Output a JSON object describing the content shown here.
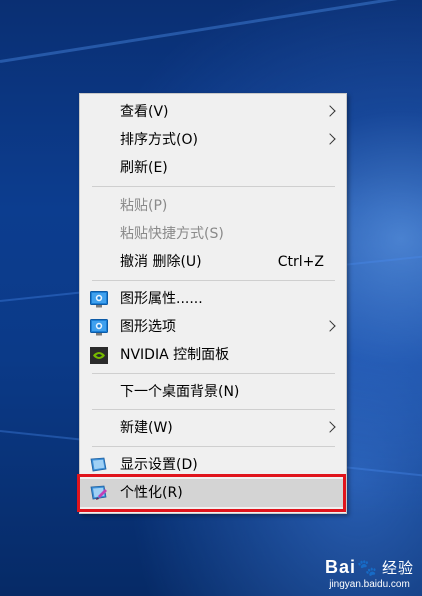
{
  "menu": {
    "items": [
      {
        "label": "查看(V)",
        "submenu": true
      },
      {
        "label": "排序方式(O)",
        "submenu": true
      },
      {
        "label": "刷新(E)"
      },
      {
        "label": "粘贴(P)",
        "disabled": true
      },
      {
        "label": "粘贴快捷方式(S)",
        "disabled": true
      },
      {
        "label": "撤消 删除(U)",
        "shortcut": "Ctrl+Z"
      },
      {
        "label": "图形属性......",
        "icon": "intel-graphics-icon"
      },
      {
        "label": "图形选项",
        "icon": "intel-graphics-icon",
        "submenu": true
      },
      {
        "label": "NVIDIA 控制面板",
        "icon": "nvidia-icon"
      },
      {
        "label": "下一个桌面背景(N)"
      },
      {
        "label": "新建(W)",
        "submenu": true
      },
      {
        "label": "显示设置(D)",
        "icon": "display-settings-icon"
      },
      {
        "label": "个性化(R)",
        "icon": "personalize-icon",
        "highlighted": true
      }
    ]
  },
  "annotation": {
    "highlight_color": "#e0141c"
  },
  "watermark": {
    "brand_left": "Bai",
    "brand_right": "经验",
    "url": "jingyan.baidu.com"
  }
}
